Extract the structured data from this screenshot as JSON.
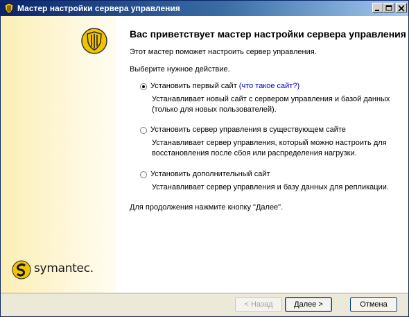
{
  "window": {
    "title": "Мастер настройки сервера управления"
  },
  "sidebar": {
    "logo_text": "symantec."
  },
  "content": {
    "heading": "Вас приветствует мастер настройки сервера управления",
    "intro": "Этот мастер поможет настроить сервер управления.",
    "prompt": "Выберите нужное действие.",
    "options": [
      {
        "label": "Установить первый сайт",
        "link": "(что такое сайт?)",
        "desc_lines": [
          "Устанавливает новый сайт с сервером управления и базой данных",
          "(только для новых пользователей)."
        ],
        "selected": true
      },
      {
        "label": "Установить сервер управления в существующем сайте",
        "desc_lines": [
          "Устанавливает сервер управления, который можно настроить для",
          "восстановления после сбоя или распределения нагрузки."
        ],
        "selected": false
      },
      {
        "label": "Установить дополнительный сайт",
        "desc_lines": [
          "Устанавливает сервер управления и базу данных для репликации."
        ],
        "selected": false
      }
    ],
    "footer_hint": "Для продолжения нажмите кнопку \"Далее\"."
  },
  "buttons": {
    "back": "< Назад",
    "next": "Далее >",
    "cancel": "Отмена"
  },
  "icons": {
    "app": "symantec-shield-icon",
    "shield": "symantec-shield-icon",
    "logo": "symantec-logo-icon",
    "minimize": "minimize-icon",
    "maximize": "maximize-icon",
    "close": "close-icon"
  },
  "colors": {
    "title_bar": "#0a246a",
    "link": "#0000c8",
    "shield_yellow": "#f2c400"
  }
}
